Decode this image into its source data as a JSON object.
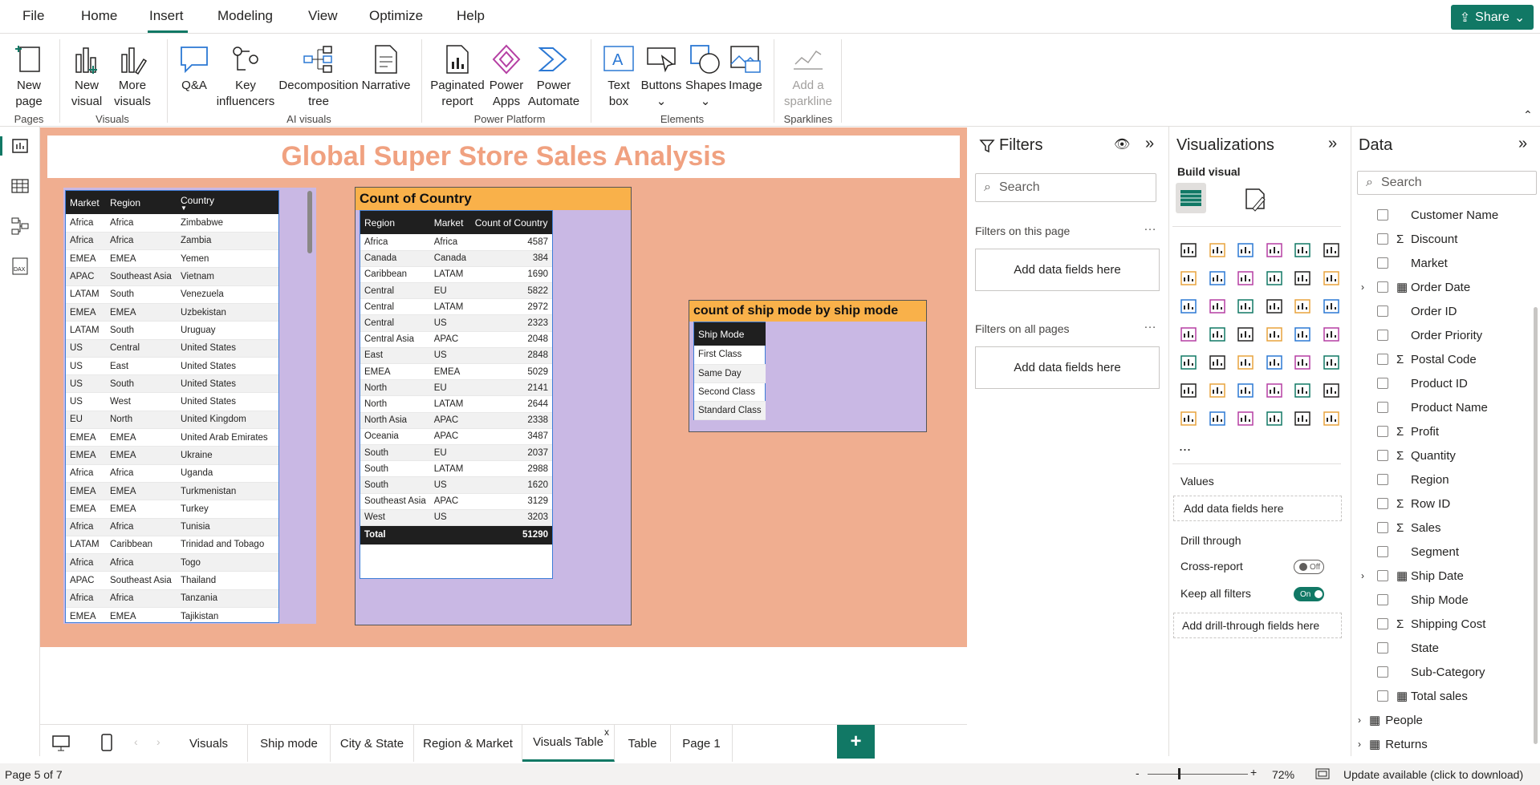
{
  "menu": {
    "items": [
      "File",
      "Home",
      "Insert",
      "Modeling",
      "View",
      "Optimize",
      "Help"
    ],
    "share": "Share"
  },
  "ribbon": {
    "buttons": "Buttons",
    "new_page_l1": "New",
    "new_page_l2": "page",
    "new_visual_l1": "New",
    "new_visual_l2": "visual",
    "more_visuals_l1": "More",
    "more_visuals_l2": "visuals",
    "qa": "Q&A",
    "key_l1": "Key",
    "key_l2": "influencers",
    "decomp_l1": "Decomposition",
    "decomp_l2": "tree",
    "narrative": "Narrative",
    "pag_l1": "Paginated",
    "pag_l2": "report",
    "papps_l1": "Power",
    "papps_l2": "Apps",
    "pauto_l1": "Power",
    "pauto_l2": "Automate",
    "text_l1": "Text",
    "text_l2": "box",
    "shapes": "Shapes",
    "image": "Image",
    "spark_l1": "Add a",
    "spark_l2": "sparkline",
    "groups": {
      "pages": "Pages",
      "visuals": "Visuals",
      "ai": "AI visuals",
      "pp": "Power Platform",
      "elements": "Elements",
      "spark": "Sparklines"
    }
  },
  "report": {
    "title": "Global Super Store Sales Analysis",
    "table1": {
      "headers": [
        "Market",
        "Region",
        "Country"
      ],
      "rows": [
        [
          "Africa",
          "Africa",
          "Zimbabwe"
        ],
        [
          "Africa",
          "Africa",
          "Zambia"
        ],
        [
          "EMEA",
          "EMEA",
          "Yemen"
        ],
        [
          "APAC",
          "Southeast Asia",
          "Vietnam"
        ],
        [
          "LATAM",
          "South",
          "Venezuela"
        ],
        [
          "EMEA",
          "EMEA",
          "Uzbekistan"
        ],
        [
          "LATAM",
          "South",
          "Uruguay"
        ],
        [
          "US",
          "Central",
          "United States"
        ],
        [
          "US",
          "East",
          "United States"
        ],
        [
          "US",
          "South",
          "United States"
        ],
        [
          "US",
          "West",
          "United States"
        ],
        [
          "EU",
          "North",
          "United Kingdom"
        ],
        [
          "EMEA",
          "EMEA",
          "United Arab Emirates"
        ],
        [
          "EMEA",
          "EMEA",
          "Ukraine"
        ],
        [
          "Africa",
          "Africa",
          "Uganda"
        ],
        [
          "EMEA",
          "EMEA",
          "Turkmenistan"
        ],
        [
          "EMEA",
          "EMEA",
          "Turkey"
        ],
        [
          "Africa",
          "Africa",
          "Tunisia"
        ],
        [
          "LATAM",
          "Caribbean",
          "Trinidad and Tobago"
        ],
        [
          "Africa",
          "Africa",
          "Togo"
        ],
        [
          "APAC",
          "Southeast Asia",
          "Thailand"
        ],
        [
          "Africa",
          "Africa",
          "Tanzania"
        ],
        [
          "EMEA",
          "EMEA",
          "Tajikistan"
        ]
      ]
    },
    "table2": {
      "title": "Count of Country",
      "headers": [
        "Region",
        "Market",
        "Count of Country"
      ],
      "rows": [
        [
          "Africa",
          "Africa",
          "4587"
        ],
        [
          "Canada",
          "Canada",
          "384"
        ],
        [
          "Caribbean",
          "LATAM",
          "1690"
        ],
        [
          "Central",
          "EU",
          "5822"
        ],
        [
          "Central",
          "LATAM",
          "2972"
        ],
        [
          "Central",
          "US",
          "2323"
        ],
        [
          "Central Asia",
          "APAC",
          "2048"
        ],
        [
          "East",
          "US",
          "2848"
        ],
        [
          "EMEA",
          "EMEA",
          "5029"
        ],
        [
          "North",
          "EU",
          "2141"
        ],
        [
          "North",
          "LATAM",
          "2644"
        ],
        [
          "North Asia",
          "APAC",
          "2338"
        ],
        [
          "Oceania",
          "APAC",
          "3487"
        ],
        [
          "South",
          "EU",
          "2037"
        ],
        [
          "South",
          "LATAM",
          "2988"
        ],
        [
          "South",
          "US",
          "1620"
        ],
        [
          "Southeast Asia",
          "APAC",
          "3129"
        ],
        [
          "West",
          "US",
          "3203"
        ]
      ],
      "total_label": "Total",
      "total_value": "51290"
    },
    "table3": {
      "title": "count of ship mode by ship mode",
      "header": "Ship Mode",
      "rows": [
        "First Class",
        "Same Day",
        "Second Class",
        "Standard Class"
      ]
    }
  },
  "filters": {
    "title": "Filters",
    "search": "Search",
    "on_page": "Filters on this page",
    "on_all": "Filters on all pages",
    "add": "Add data fields here"
  },
  "viz": {
    "title": "Visualizations",
    "build": "Build visual",
    "values": "Values",
    "add_values": "Add data fields here",
    "drill": "Drill through",
    "cross": "Cross-report",
    "cross_state": "Off",
    "keep": "Keep all filters",
    "keep_state": "On",
    "add_drill": "Add drill-through fields here",
    "more": "..."
  },
  "data": {
    "title": "Data",
    "search": "Search",
    "fields": [
      {
        "name": "Customer Name",
        "sigma": false,
        "expand": false,
        "cal": false
      },
      {
        "name": "Discount",
        "sigma": true,
        "expand": false,
        "cal": false
      },
      {
        "name": "Market",
        "sigma": false,
        "expand": false,
        "cal": false
      },
      {
        "name": "Order Date",
        "sigma": false,
        "expand": true,
        "cal": true
      },
      {
        "name": "Order ID",
        "sigma": false,
        "expand": false,
        "cal": false
      },
      {
        "name": "Order Priority",
        "sigma": false,
        "expand": false,
        "cal": false
      },
      {
        "name": "Postal Code",
        "sigma": true,
        "expand": false,
        "cal": false
      },
      {
        "name": "Product ID",
        "sigma": false,
        "expand": false,
        "cal": false
      },
      {
        "name": "Product Name",
        "sigma": false,
        "expand": false,
        "cal": false
      },
      {
        "name": "Profit",
        "sigma": true,
        "expand": false,
        "cal": false
      },
      {
        "name": "Quantity",
        "sigma": true,
        "expand": false,
        "cal": false
      },
      {
        "name": "Region",
        "sigma": false,
        "expand": false,
        "cal": false
      },
      {
        "name": "Row ID",
        "sigma": true,
        "expand": false,
        "cal": false
      },
      {
        "name": "Sales",
        "sigma": true,
        "expand": false,
        "cal": false
      },
      {
        "name": "Segment",
        "sigma": false,
        "expand": false,
        "cal": false
      },
      {
        "name": "Ship Date",
        "sigma": false,
        "expand": true,
        "cal": true
      },
      {
        "name": "Ship Mode",
        "sigma": false,
        "expand": false,
        "cal": false
      },
      {
        "name": "Shipping Cost",
        "sigma": true,
        "expand": false,
        "cal": false
      },
      {
        "name": "State",
        "sigma": false,
        "expand": false,
        "cal": false
      },
      {
        "name": "Sub-Category",
        "sigma": false,
        "expand": false,
        "cal": false
      },
      {
        "name": "Total sales",
        "sigma": false,
        "expand": false,
        "cal": true
      }
    ],
    "tables": [
      "People",
      "Returns"
    ]
  },
  "tabs": [
    "Visuals",
    "Ship mode",
    "City & State",
    "Region & Market",
    "Visuals Table",
    "Table",
    "Page 1"
  ],
  "active_tab": "Visuals Table",
  "status": {
    "page": "Page 5 of 7",
    "zoom": "72%",
    "update": "Update available (click to download)"
  },
  "colors": {
    "accent": "#117865",
    "canvas": "#f0ae90",
    "visual_bg": "#c9b8e4",
    "header": "#f9b14a",
    "title": "#f0a180"
  }
}
